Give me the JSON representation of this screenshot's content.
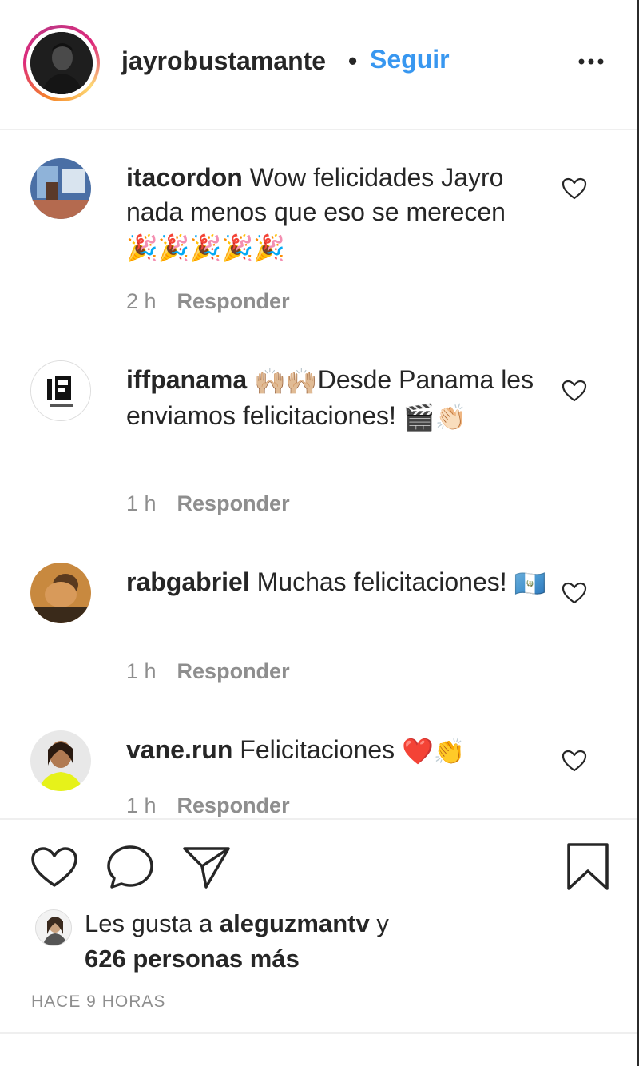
{
  "header": {
    "username": "jayrobustamante",
    "separator": "•",
    "follow_label": "Seguir"
  },
  "comments": [
    {
      "username": "itacordon",
      "text": "Wow felicidades Jayro nada menos que eso se merecen",
      "emoji": "🎉🎉🎉🎉🎉",
      "time": "2 h",
      "reply_label": "Responder"
    },
    {
      "username": "iffpanama",
      "emoji_before": "🙌🏼🙌🏼",
      "text": "Desde Panama les enviamos felicitaciones!",
      "emoji": "🎬👏🏻",
      "time": "1 h",
      "reply_label": "Responder"
    },
    {
      "username": "rabgabriel",
      "text": "Muchas felicitaciones!",
      "emoji": "🇬🇹",
      "time": "1 h",
      "reply_label": "Responder"
    },
    {
      "username": "vane.run",
      "text": "Felicitaciones",
      "emoji": "❤️👏",
      "time": "1 h",
      "reply_label": "Responder"
    }
  ],
  "likes": {
    "prefix": "Les gusta a",
    "liker": "aleguzmantv",
    "conjunction": "y",
    "others": "626 personas más"
  },
  "time_ago": "HACE 9 HORAS",
  "colors": {
    "accent": "#3897f0",
    "text": "#262626",
    "muted": "#8e8e8e"
  }
}
